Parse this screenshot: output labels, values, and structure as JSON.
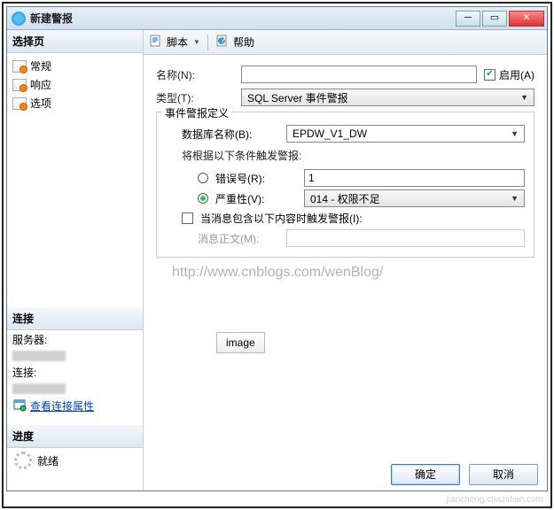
{
  "window": {
    "title": "新建警报"
  },
  "sidebar": {
    "pages_header": "选择页",
    "items": [
      {
        "label": "常规"
      },
      {
        "label": "响应"
      },
      {
        "label": "选项"
      }
    ],
    "connection_header": "连接",
    "server_label": "服务器:",
    "conn_label": "连接:",
    "view_props": "查看连接属性",
    "progress_header": "进度",
    "ready": "就绪"
  },
  "toolbar": {
    "script": "脚本",
    "help": "帮助"
  },
  "form": {
    "name_label": "名称(N):",
    "name_value": "",
    "enable_label": "启用(A)",
    "type_label": "类型(T):",
    "type_value": "SQL Server 事件警报",
    "fieldset": "事件警报定义",
    "db_label": "数据库名称(B):",
    "db_value": "EPDW_V1_DW",
    "cond_text": "将根据以下条件触发警报:",
    "errno_label": "错误号(R):",
    "errno_value": "1",
    "sev_label": "严重性(V):",
    "sev_value": "014 - 权限不足",
    "msg_contains_label": "当消息包含以下内容时触发警报(I):",
    "msg_text_label": "消息正文(M):"
  },
  "watermark": "http://www.cnblogs.com/wenBlog/",
  "image_label": "image",
  "buttons": {
    "ok": "确定",
    "cancel": "取消"
  },
  "bottom_watermark": "jiaocheng.chazidian.com"
}
